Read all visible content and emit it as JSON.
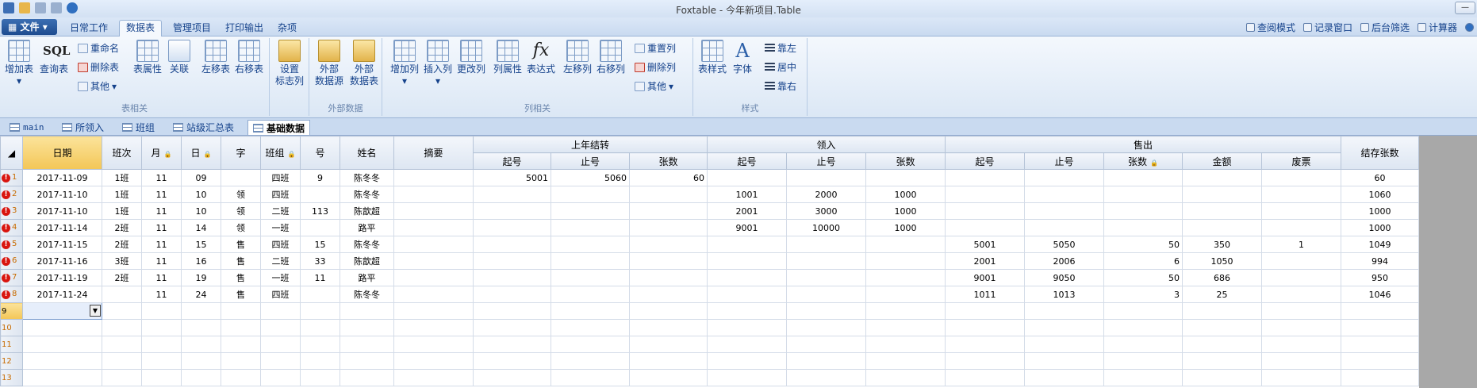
{
  "window": {
    "title": "Foxtable - 今年新项目.Table"
  },
  "ribbon_tabs": {
    "file": "文件",
    "items": [
      "日常工作",
      "数据表",
      "管理项目",
      "打印输出",
      "杂项"
    ],
    "active": "数据表"
  },
  "right_tools": [
    "查阅模式",
    "记录窗口",
    "后台筛选",
    "计算器"
  ],
  "ribbon": {
    "table_group": {
      "label": "表相关",
      "add_table": "增加表",
      "query_table": "查询表",
      "sql": "SQL",
      "rename": "重命名",
      "delete_table": "删除表",
      "other": "其他",
      "table_props": "表属性",
      "relation": "关联",
      "move_left": "左移表",
      "move_right": "右移表",
      "set_mark_col_1": "设置",
      "set_mark_col_2": "标志列"
    },
    "external_group": {
      "label": "外部数据",
      "ext_source_1": "外部",
      "ext_source_2": "数据源",
      "ext_table_1": "外部",
      "ext_table_2": "数据表"
    },
    "column_group": {
      "label": "列相关",
      "add_col": "增加列",
      "insert_col": "插入列",
      "change_col": "更改列",
      "col_props": "列属性",
      "expression": "表达式",
      "col_left": "左移列",
      "col_right": "右移列",
      "reset_col": "重置列",
      "delete_col": "删除列",
      "other": "其他"
    },
    "style_group": {
      "label": "样式",
      "table_style": "表样式",
      "font": "字体",
      "align_left": "靠左",
      "align_center": "居中",
      "align_right": "靠右"
    }
  },
  "sheet_tabs": [
    "main",
    "所领入",
    "班组",
    "站级汇总表",
    "基础数据"
  ],
  "active_sheet": "基础数据",
  "grid": {
    "headers_top": {
      "date": "日期",
      "shift": "班次",
      "month": "月",
      "day": "日",
      "char": "字",
      "team": "班组",
      "num": "号",
      "name": "姓名",
      "summary": "摘要",
      "carry": "上年结转",
      "received": "领入",
      "sold": "售出",
      "balance": "结存张数"
    },
    "headers_sub": {
      "start": "起号",
      "end": "止号",
      "count": "张数",
      "amount": "金额",
      "void": "废票"
    },
    "rows": [
      {
        "n": "1",
        "err": true,
        "date": "2017-11-09",
        "shift": "1班",
        "month": "11",
        "day": "09",
        "char": "",
        "team": "四班",
        "num": "9",
        "name": "陈冬冬",
        "c_start": "5001",
        "c_end": "5060",
        "c_count": "60",
        "r_start": "",
        "r_end": "",
        "r_count": "",
        "s_start": "",
        "s_end": "",
        "s_count": "",
        "s_amount": "",
        "s_void": "",
        "bal": "60"
      },
      {
        "n": "2",
        "err": true,
        "date": "2017-11-10",
        "shift": "1班",
        "month": "11",
        "day": "10",
        "char": "领",
        "team": "四班",
        "num": "",
        "name": "陈冬冬",
        "c_start": "",
        "c_end": "",
        "c_count": "",
        "r_start": "1001",
        "r_end": "2000",
        "r_count": "1000",
        "s_start": "",
        "s_end": "",
        "s_count": "",
        "s_amount": "",
        "s_void": "",
        "bal": "1060"
      },
      {
        "n": "3",
        "err": true,
        "date": "2017-11-10",
        "shift": "1班",
        "month": "11",
        "day": "10",
        "char": "领",
        "team": "二班",
        "num": "113",
        "name": "陈歆超",
        "c_start": "",
        "c_end": "",
        "c_count": "",
        "r_start": "2001",
        "r_end": "3000",
        "r_count": "1000",
        "s_start": "",
        "s_end": "",
        "s_count": "",
        "s_amount": "",
        "s_void": "",
        "bal": "1000"
      },
      {
        "n": "4",
        "err": true,
        "date": "2017-11-14",
        "shift": "2班",
        "month": "11",
        "day": "14",
        "char": "领",
        "team": "一班",
        "num": "",
        "name": "路平",
        "c_start": "",
        "c_end": "",
        "c_count": "",
        "r_start": "9001",
        "r_end": "10000",
        "r_count": "1000",
        "s_start": "",
        "s_end": "",
        "s_count": "",
        "s_amount": "",
        "s_void": "",
        "bal": "1000"
      },
      {
        "n": "5",
        "err": true,
        "date": "2017-11-15",
        "shift": "2班",
        "month": "11",
        "day": "15",
        "char": "售",
        "team": "四班",
        "num": "15",
        "name": "陈冬冬",
        "c_start": "",
        "c_end": "",
        "c_count": "",
        "r_start": "",
        "r_end": "",
        "r_count": "",
        "s_start": "5001",
        "s_end": "5050",
        "s_count": "50",
        "s_amount": "350",
        "s_void": "1",
        "bal": "1049"
      },
      {
        "n": "6",
        "err": true,
        "date": "2017-11-16",
        "shift": "3班",
        "month": "11",
        "day": "16",
        "char": "售",
        "team": "二班",
        "num": "33",
        "name": "陈歆超",
        "c_start": "",
        "c_end": "",
        "c_count": "",
        "r_start": "",
        "r_end": "",
        "r_count": "",
        "s_start": "2001",
        "s_end": "2006",
        "s_count": "6",
        "s_amount": "1050",
        "s_void": "",
        "bal": "994"
      },
      {
        "n": "7",
        "err": true,
        "date": "2017-11-19",
        "shift": "2班",
        "month": "11",
        "day": "19",
        "char": "售",
        "team": "一班",
        "num": "11",
        "name": "路平",
        "c_start": "",
        "c_end": "",
        "c_count": "",
        "r_start": "",
        "r_end": "",
        "r_count": "",
        "s_start": "9001",
        "s_end": "9050",
        "s_count": "50",
        "s_amount": "686",
        "s_void": "",
        "bal": "950"
      },
      {
        "n": "8",
        "err": true,
        "date": "2017-11-24",
        "shift": "",
        "month": "11",
        "day": "24",
        "char": "售",
        "team": "四班",
        "num": "",
        "name": "陈冬冬",
        "c_start": "",
        "c_end": "",
        "c_count": "",
        "r_start": "",
        "r_end": "",
        "r_count": "",
        "s_start": "1011",
        "s_end": "1013",
        "s_count": "3",
        "s_amount": "25",
        "s_void": "",
        "bal": "1046"
      }
    ],
    "empty_rows": [
      "9",
      "10",
      "11",
      "12",
      "13"
    ]
  }
}
